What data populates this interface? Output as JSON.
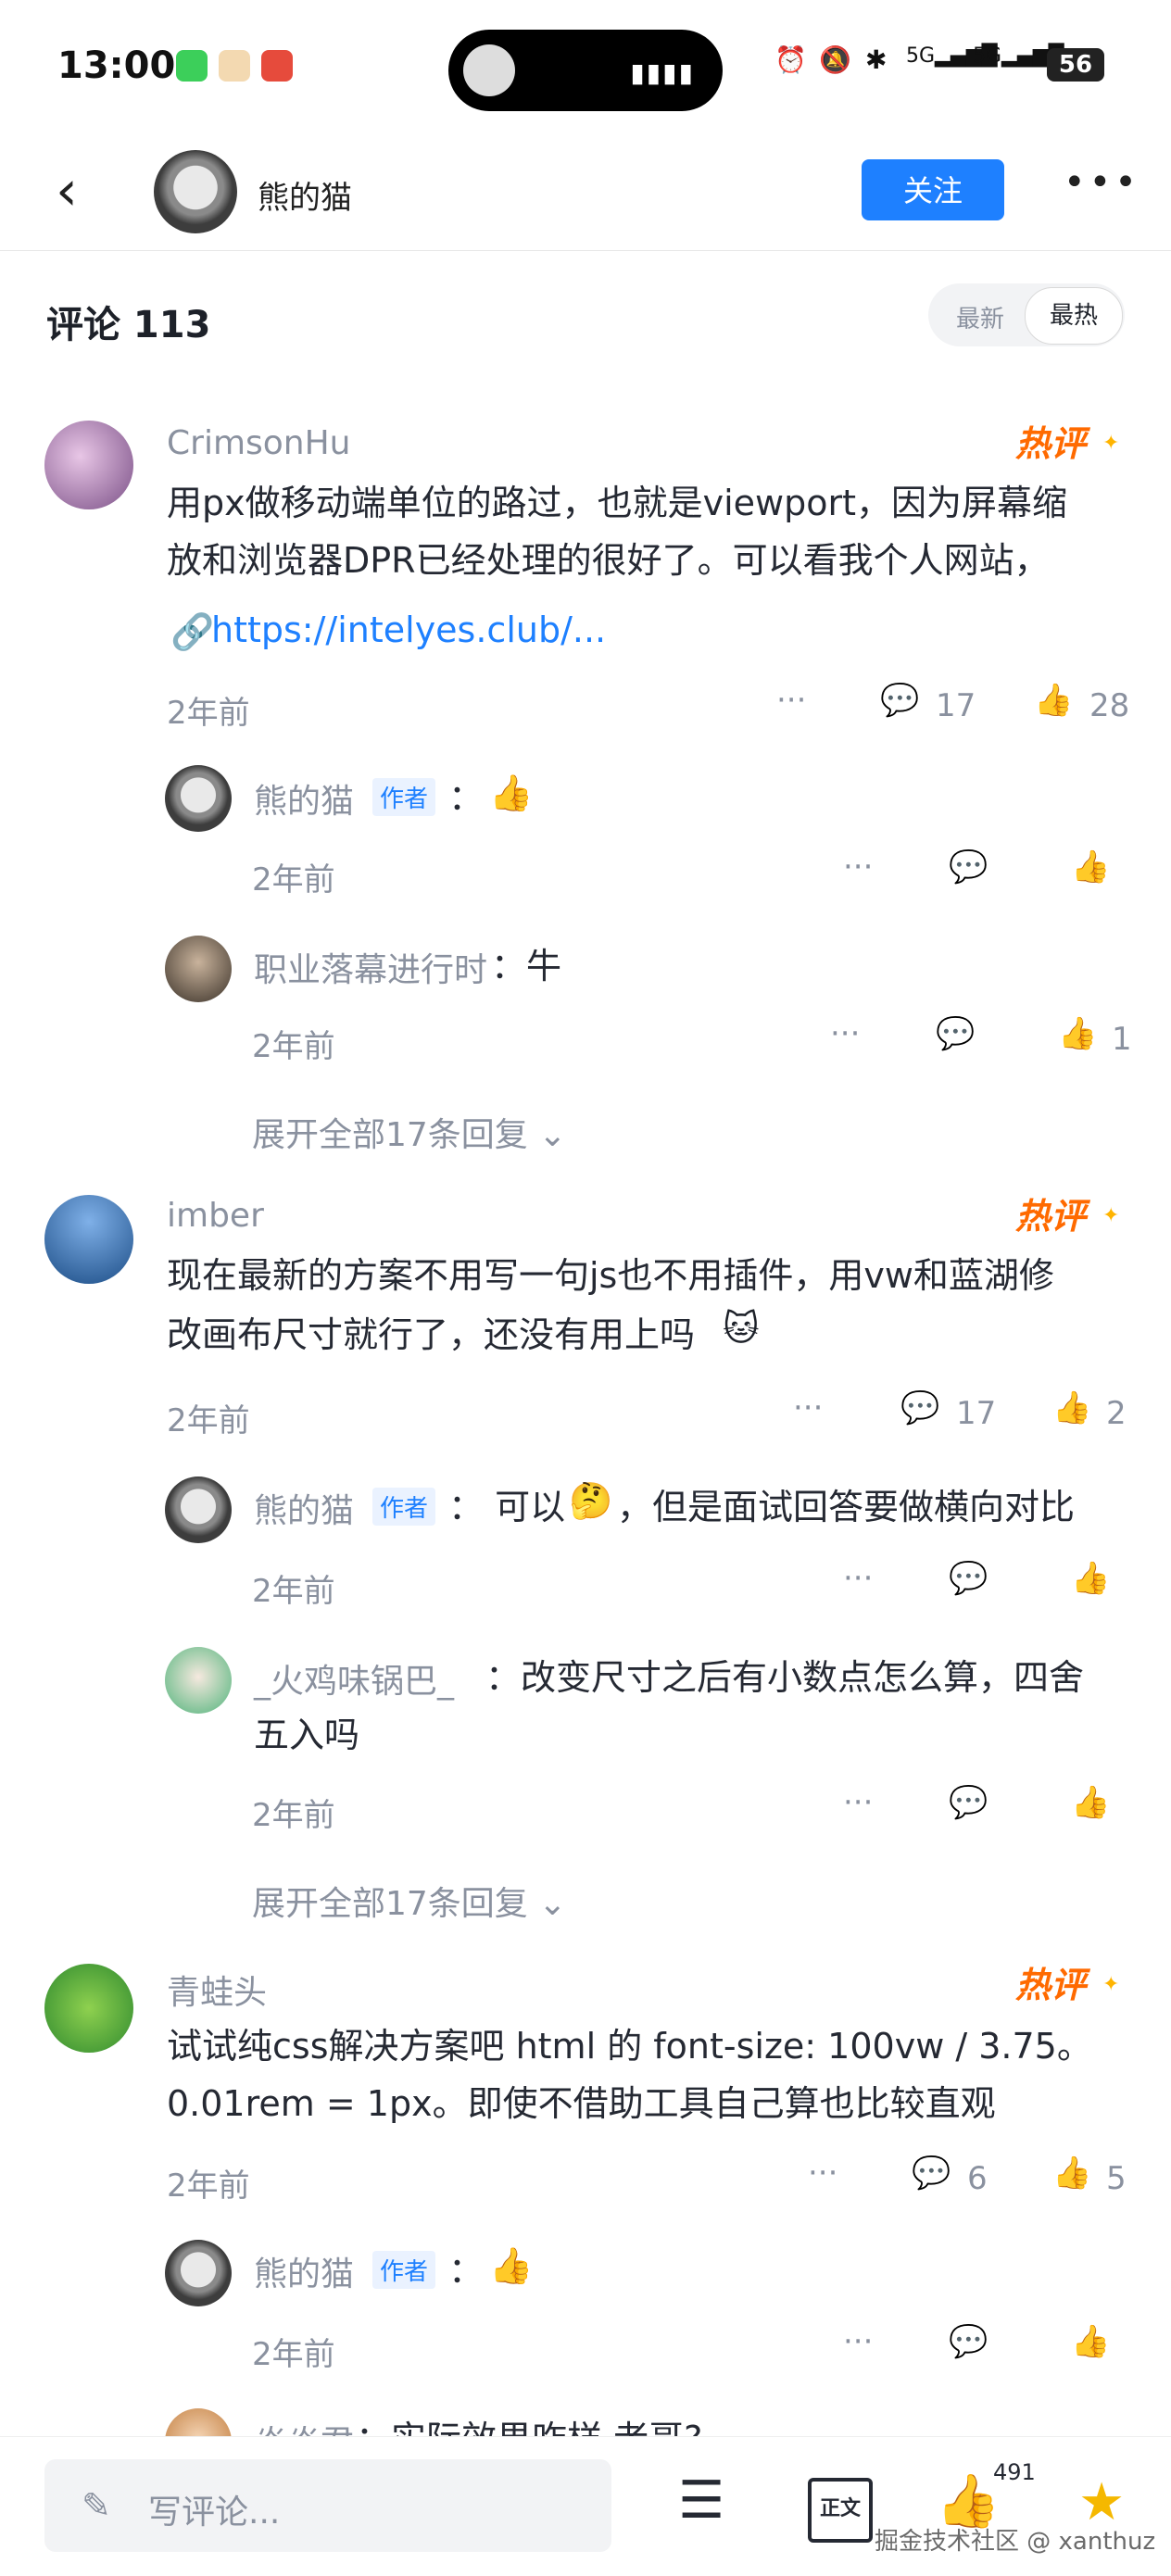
{
  "status_bar": {
    "time": "13:00",
    "battery": "56",
    "signal1": "5G",
    "signal2": "5G"
  },
  "header": {
    "name": "熊的猫",
    "follow_label": "关注",
    "more": "•••"
  },
  "comments_header": {
    "title": "评论 113",
    "sort_new": "最新",
    "sort_hot": "最热"
  },
  "hot_label": "热评",
  "comments": [
    {
      "user": "CrimsonHu",
      "text1": "用px做移动端单位的路过，也就是viewport，因为屏幕缩",
      "text2": "放和浏览器DPR已经处理的很好了。可以看我个人网站，",
      "link": "https://intelyes.club/...",
      "time": "2年前",
      "reply_count": "17",
      "like_count": "28",
      "replies": [
        {
          "user": "熊的猫",
          "tag": "作者",
          "text": "：",
          "emoji": "👍",
          "time": "2年前",
          "like_count": ""
        },
        {
          "user": "职业落幕进行时",
          "text": "：牛",
          "time": "2年前",
          "like_count": "1"
        }
      ],
      "expand": "展开全部17条回复"
    },
    {
      "user": "imber",
      "text1": "现在最新的方案不用写一句js也不用插件，用vw和蓝湖修",
      "text2": "改画布尺寸就行了，还没有用上吗",
      "emoji": "🐱",
      "time": "2年前",
      "reply_count": "17",
      "like_count": "2",
      "replies": [
        {
          "user": "熊的猫",
          "tag": "作者",
          "text": "：  可以",
          "emoji": "🤔",
          "text_after": "，但是面试回答要做横向对比",
          "time": "2年前"
        },
        {
          "user": "_火鸡味锅巴_",
          "text1": "：改变尺寸之后有小数点怎么算，四舍",
          "text2": "五入吗",
          "time": "2年前"
        }
      ],
      "expand": "展开全部17条回复"
    },
    {
      "user": "青蛙头",
      "text1": "试试纯css解决方案吧 html 的 font-size: 100vw / 3.75。",
      "text2": "0.01rem = 1px。即使不借助工具自己算也比较直观",
      "time": "2年前",
      "reply_count": "6",
      "like_count": "5",
      "replies": [
        {
          "user": "熊的猫",
          "tag": "作者",
          "text": "：",
          "emoji": "👍",
          "time": "2年前"
        },
        {
          "user": "焱焱君",
          "text": "：实际效果咋样 老哥?"
        }
      ]
    }
  ],
  "bottom_bar": {
    "placeholder": "写评论...",
    "like_count": "491",
    "watermark": "掘金技术社区 @ xanthuz",
    "article_label": "正文"
  },
  "colors": {
    "accent": "#1e80ff",
    "hot": "#ff6a00",
    "muted": "#8a919f"
  }
}
